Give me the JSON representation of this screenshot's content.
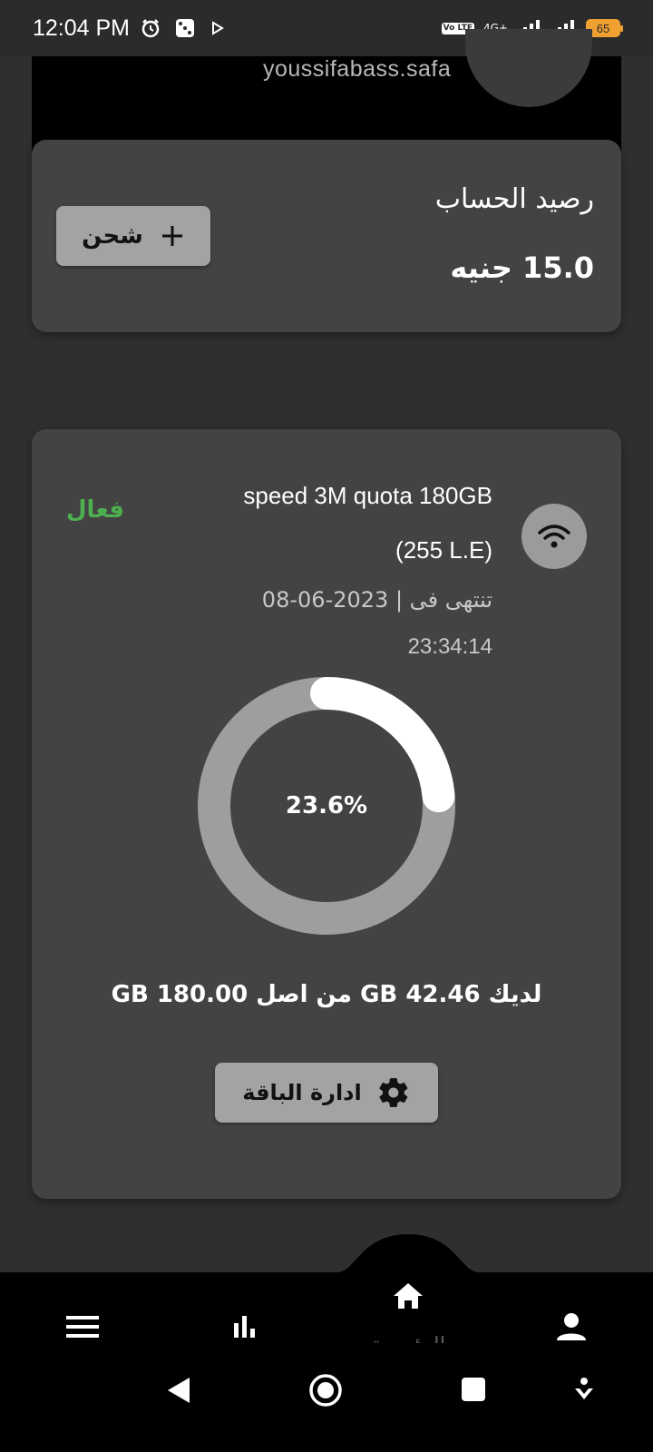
{
  "status_bar": {
    "time": "12:04 PM",
    "volte": "Vo LTE",
    "network_type": "4G+",
    "battery_level": "65",
    "icons": [
      "alarm-icon",
      "dice-icon",
      "play-icon",
      "signal-icon",
      "signal-icon",
      "battery-icon"
    ]
  },
  "profile": {
    "username": "youssifabass.safa"
  },
  "balance": {
    "label": "رصيد الحساب",
    "value": "15.0 جنيه",
    "charge_button_label": "شحن"
  },
  "package": {
    "status": "فعال",
    "name": "speed 3M quota 180GB",
    "price": "(255 L.E)",
    "expiry_label": "تنتهى فى | 2023-06-08",
    "expiry_time": "23:34:14",
    "usage_percent_label": "23.6%",
    "usage_fraction": 0.236,
    "remaining_text": "لديك 42.46 GB من اصل 180.00 GB",
    "manage_button_label": "ادارة الباقة"
  },
  "bottom_nav": {
    "home_label": "الرئيسية",
    "items": [
      "menu-icon",
      "stats-icon",
      "home-icon",
      "profile-icon"
    ]
  },
  "colors": {
    "background": "#2f2f2f",
    "card": "#434343",
    "active_green": "#4caf50",
    "button_gray": "#a3a3a3",
    "donut_track": "#9e9e9e",
    "donut_progress": "#ffffff"
  }
}
